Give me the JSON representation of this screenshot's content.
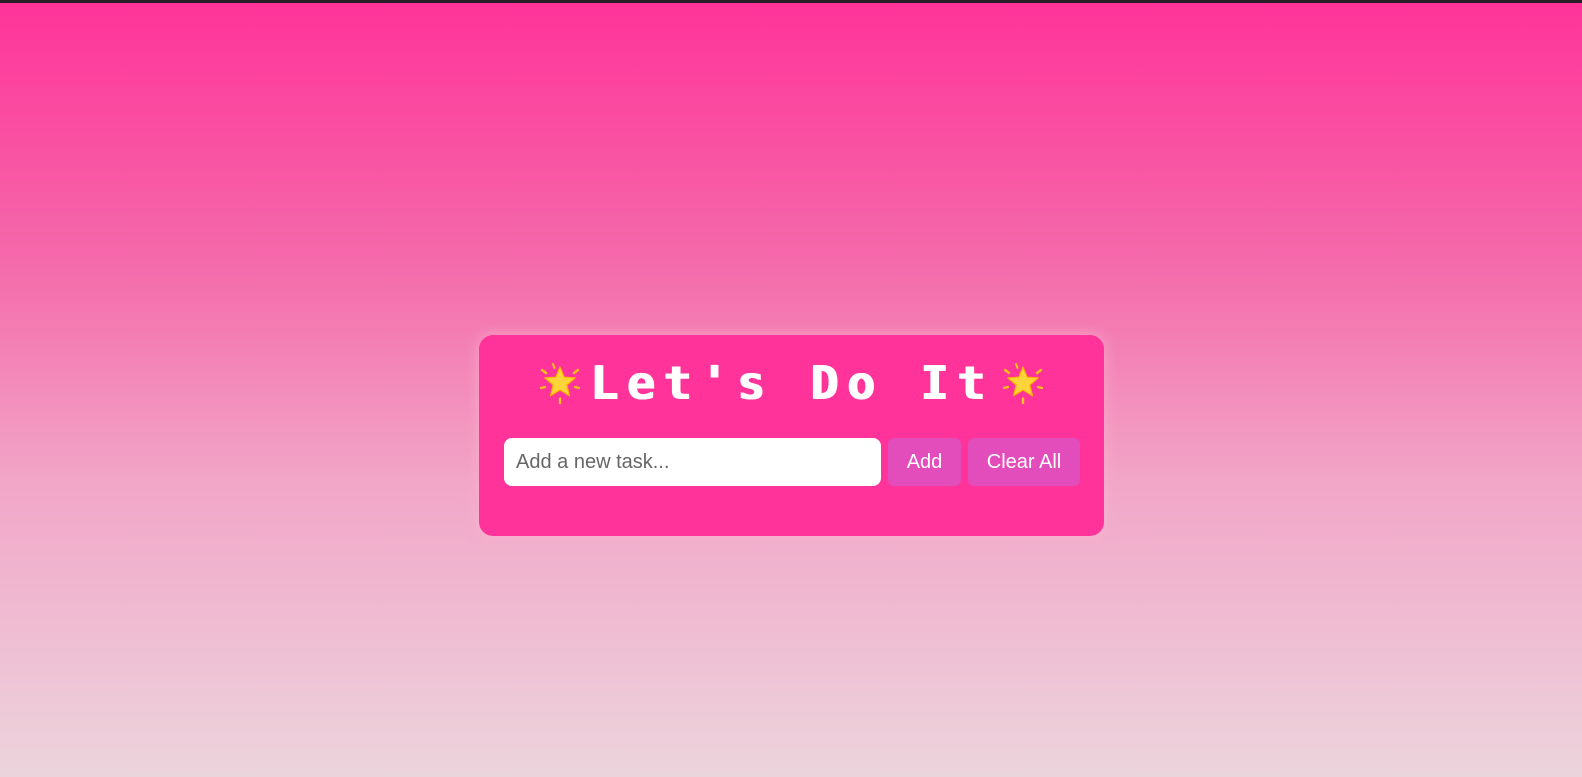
{
  "app": {
    "title": "Let's Do It"
  },
  "header": {
    "title": "Let's Do It",
    "left_icon": "glowing-star-icon",
    "right_icon": "glowing-star-icon",
    "icon_color": "#ffd43b"
  },
  "task_form": {
    "input_value": "",
    "input_placeholder": "Add a new task...",
    "add_label": "Add",
    "clear_label": "Clear All"
  },
  "tasks": [],
  "colors": {
    "card_background": "#ff3399",
    "button_background": "#e24cbb",
    "page_gradient_top": "#ff3399",
    "page_gradient_bottom": "#ecd4dc",
    "title_text": "#ffffff"
  }
}
